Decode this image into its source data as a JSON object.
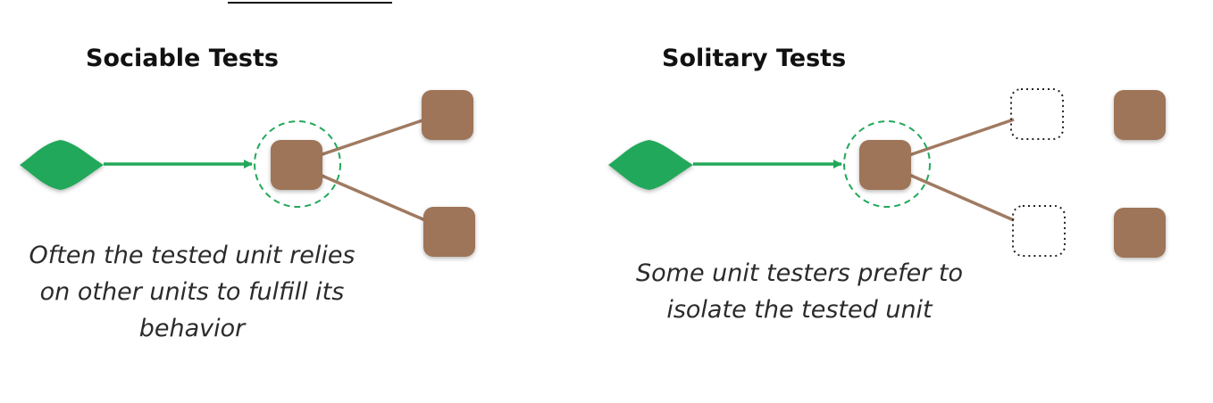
{
  "sociable": {
    "title": "Sociable Tests",
    "caption_lines": [
      "Often the tested unit relies",
      "on other units to fulfill its",
      "behavior"
    ]
  },
  "solitary": {
    "title": "Solitary Tests",
    "caption_lines": [
      "Some unit testers prefer to",
      "isolate the tested unit"
    ]
  },
  "colors": {
    "green": "#22a85a",
    "brown": "#9e7558",
    "connector": "#a07a61",
    "stub_border": "#222222"
  }
}
